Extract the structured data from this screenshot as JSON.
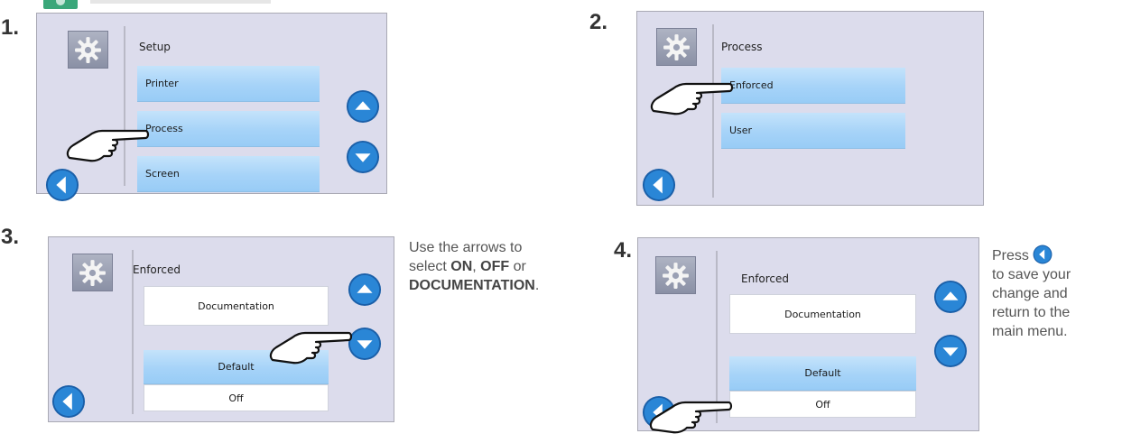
{
  "icons": {
    "settings": "gear-icon",
    "up": "arrow-up-icon",
    "down": "arrow-down-icon",
    "back": "back-arrow-icon",
    "pointer": "pointing-hand-icon"
  },
  "colors": {
    "accent_blue": "#1976c8",
    "menu_item": "#a6d3f8",
    "screen_bg": "#dcdcec"
  },
  "steps": [
    {
      "number": "1.",
      "screen": {
        "title": "Setup",
        "items": [
          "Printer",
          "Process",
          "Screen"
        ]
      }
    },
    {
      "number": "2.",
      "screen": {
        "title": "Process",
        "items": [
          "Enforced",
          "User"
        ]
      }
    },
    {
      "number": "3.",
      "screen": {
        "title": "Enforced",
        "value": "Documentation",
        "options": [
          "Default",
          "Off"
        ]
      },
      "instruction": {
        "line1": "Use the arrows to",
        "line2_pre": "select ",
        "on": "ON",
        "sep1": ", ",
        "off": "OFF",
        "sep2": " or",
        "doc": "DOCUMENTATION",
        "end": "."
      }
    },
    {
      "number": "4.",
      "screen": {
        "title": "Enforced",
        "value": "Documentation",
        "options": [
          "Default",
          "Off"
        ]
      },
      "instruction": {
        "line1": "Press",
        "line2": "to save your",
        "line3": "change and",
        "line4": "return to the",
        "line5": "main menu."
      }
    }
  ]
}
